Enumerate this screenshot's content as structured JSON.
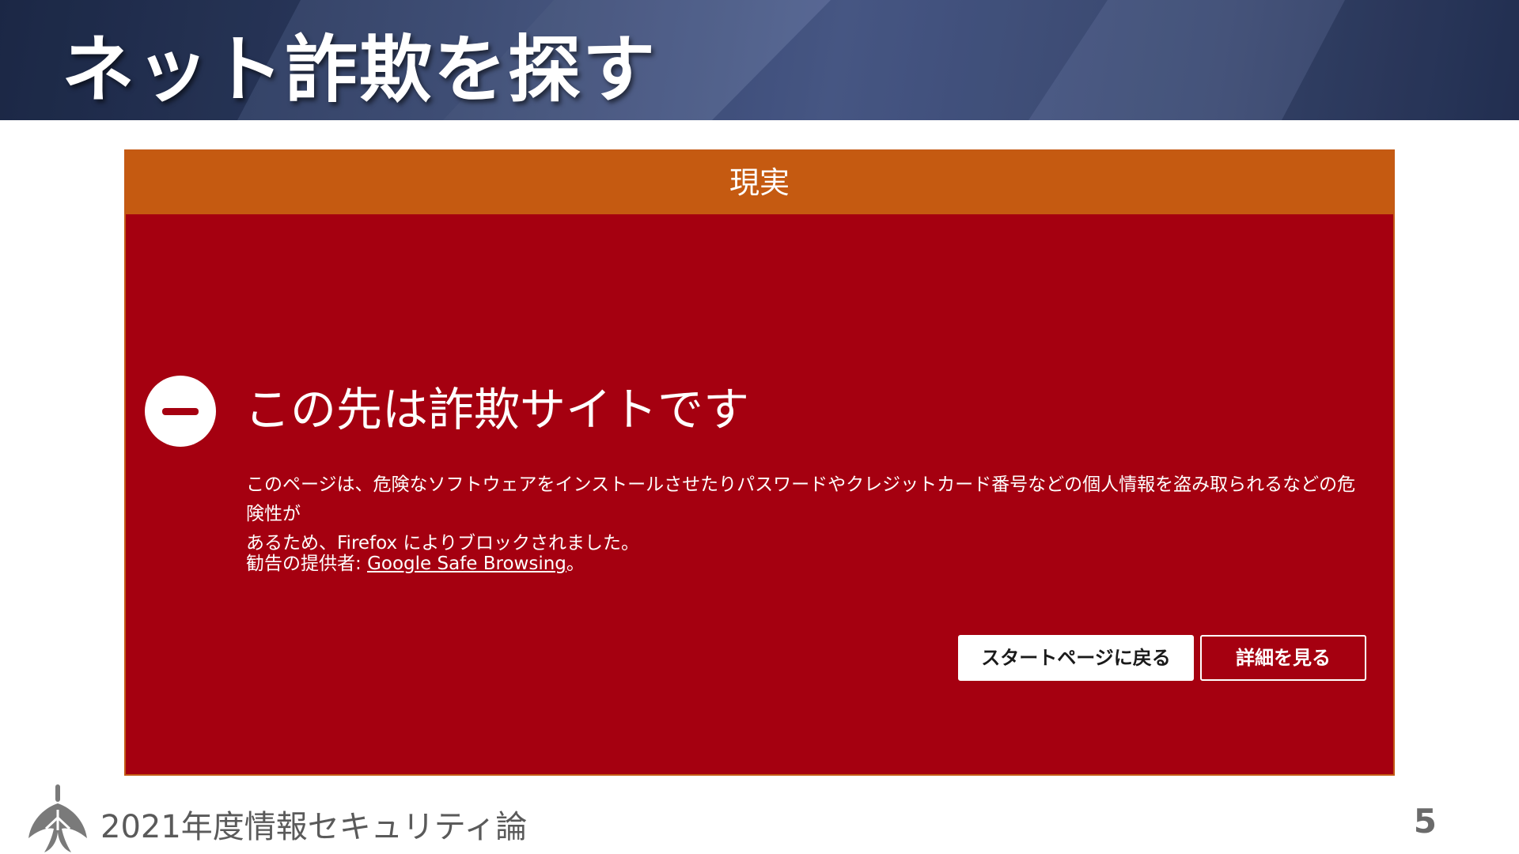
{
  "slide": {
    "title": "ネット詐欺を探す",
    "footer_text": "2021年度情報セキュリティ論",
    "page_number": "5"
  },
  "panel": {
    "label": "現実",
    "label_color": "#c55a11",
    "background_color": "#a50010"
  },
  "warning": {
    "icon": "blocked-minus-icon",
    "title": "この先は詐欺サイトです",
    "description_line1": "このページは、危険なソフトウェアをインストールさせたりパスワードやクレジットカード番号などの個人情報を盗み取られるなどの危険性が",
    "description_line2": "あるため、Firefox によりブロックされました。",
    "provider_prefix": "勧告の提供者: ",
    "provider_link": "Google Safe Browsing",
    "provider_suffix": "。"
  },
  "buttons": {
    "back_label": "スタートページに戻る",
    "details_label": "詳細を見る"
  }
}
